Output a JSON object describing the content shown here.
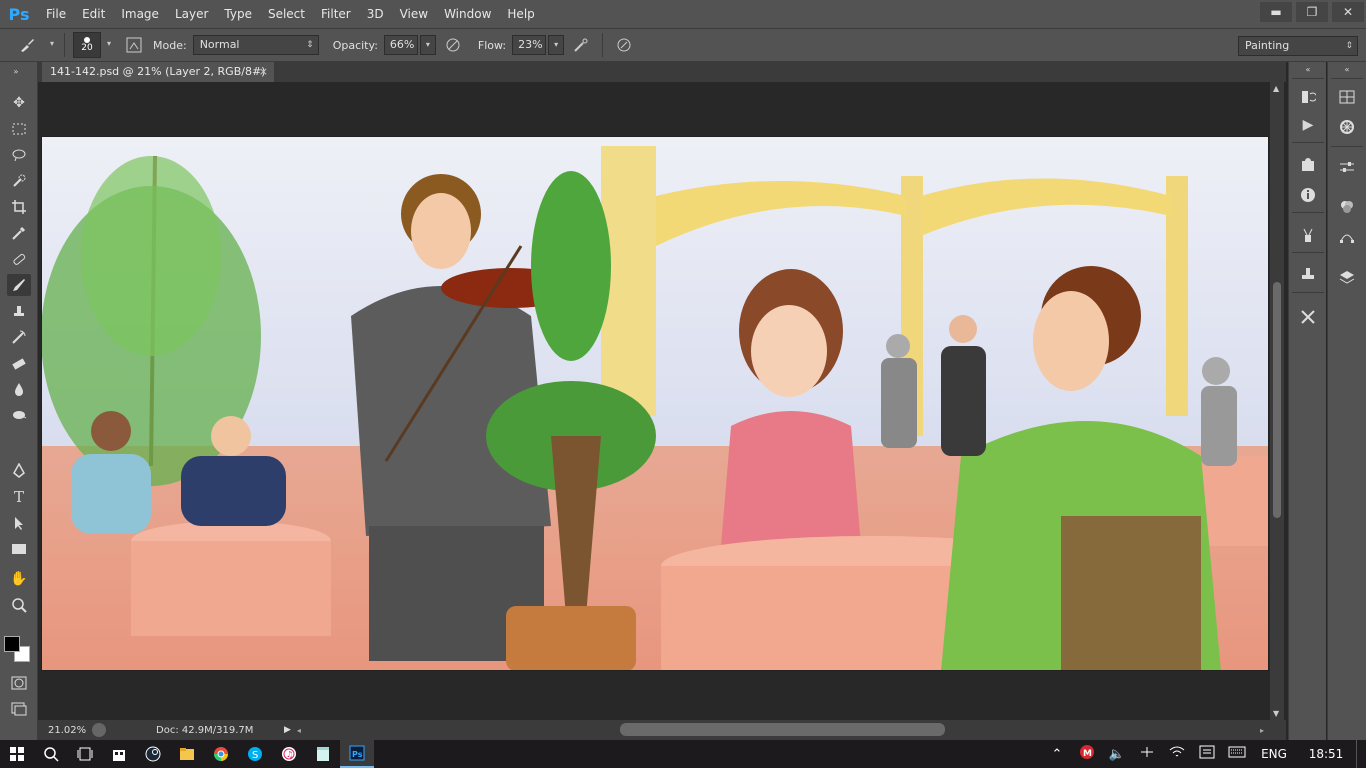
{
  "app": {
    "logo": "Ps"
  },
  "menu": [
    "File",
    "Edit",
    "Image",
    "Layer",
    "Type",
    "Select",
    "Filter",
    "3D",
    "View",
    "Window",
    "Help"
  ],
  "window_controls": {
    "minimize": "▬",
    "restore": "❐",
    "close": "✕"
  },
  "options": {
    "brush_size": "20",
    "mode_label": "Mode:",
    "mode_value": "Normal",
    "opacity_label": "Opacity:",
    "opacity_value": "66%",
    "flow_label": "Flow:",
    "flow_value": "23%",
    "workspace": "Painting"
  },
  "document": {
    "tab_title": "141-142.psd @ 21% (Layer 2, RGB/8#) *",
    "close": "×"
  },
  "status": {
    "zoom": "21.02%",
    "doc_size": "Doc: 42.9M/319.7M"
  },
  "taskbar": {
    "language": "ENG",
    "time": "18:51"
  },
  "icons": {
    "tools": [
      "move-icon",
      "marquee-icon",
      "lasso-icon",
      "quick-select-icon",
      "crop-icon",
      "eyedropper-icon",
      "healing-brush-icon",
      "brush-icon",
      "clone-stamp-icon",
      "history-brush-icon",
      "eraser-icon",
      "paint-bucket-icon",
      "blur-icon",
      "dodge-icon",
      "pen-icon",
      "type-icon",
      "path-select-icon",
      "rectangle-icon",
      "hand-icon",
      "zoom-icon"
    ],
    "dock1": [
      "history-icon",
      "actions-icon",
      "brush-presets-icon",
      "info-icon",
      "clone-source-icon",
      "tool-presets-icon",
      "tools-icon"
    ],
    "dock2": [
      "navigator-icon",
      "color-wheel-icon",
      "adjustments-icon",
      "styles-icon",
      "paths-icon",
      "layers-icon"
    ]
  },
  "colors": {
    "foreground": "#000000",
    "background": "#ffffff",
    "accent": "#31a8ff"
  }
}
